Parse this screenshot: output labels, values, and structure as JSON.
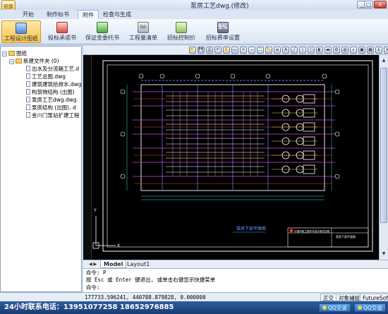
{
  "window": {
    "title": "泵房工艺dwg.(修改)",
    "logo_text": "预算",
    "minimize": "_",
    "maximize": "□",
    "close": "×"
  },
  "tabs": [
    "开始",
    "制作标书",
    "附件",
    "检查与生成"
  ],
  "ribbon": {
    "buttons": [
      {
        "label": "工程设计图纸",
        "icon": "drawing-icon"
      },
      {
        "label": "投标承诺书",
        "icon": "document-icon"
      },
      {
        "label": "保证金委托书",
        "icon": "stamp-icon"
      },
      {
        "label": "工程量清单",
        "icon": "list-icon"
      },
      {
        "label": "招标控制价",
        "icon": "money-icon"
      },
      {
        "label": "招标费率设置",
        "icon": "percent-icon"
      }
    ],
    "list_icon_text": "list",
    "percent_icon_text": "5%"
  },
  "tree": {
    "root": "图纸",
    "folder": "新建文件夹 (0)",
    "files": [
      "出水及分流箱工艺.d",
      "工艺总图.dwg",
      "建筑建筑给排水.dwg",
      "构筑物结构 (出图)",
      "泵房工艺dwg.dwg",
      "泵房结构 (出图). d",
      "金川门泵站扩建工程"
    ]
  },
  "cad": {
    "toolbar_icons": [
      "open-icon",
      "save-icon",
      "print-icon",
      "undo-icon",
      "pan-icon",
      "zoom-window-icon",
      "zoom-in-icon",
      "zoom-out-icon",
      "zoom-extents-icon",
      "measure-icon",
      "layer-icon",
      "text-icon",
      "line-icon",
      "polyline-icon",
      "circle-icon",
      "color-icon",
      "lineweight-icon",
      "settings-icon",
      "globe-icon",
      "search-icon",
      "pdf-icon",
      "picture-icon",
      "info-icon",
      "clear-icon"
    ],
    "ucs_label_y": "Y",
    "ucs_label_x": "X",
    "drawing_title": "泵房下部平面图",
    "company": "中国市政工程华东设计研究总院",
    "sheet_title": "泵房下部平面图"
  },
  "layout_tabs": [
    "Model",
    "Layout1"
  ],
  "command": {
    "line1": "命令: P",
    "line2": "按 Esc 或 Enter 键退出, 或单击右键显示快捷菜单",
    "line3": "命令:"
  },
  "status": {
    "coords": "177733.596241, 440788.879828, 0.000000",
    "buttons": [
      "正交",
      "对象捕捉",
      "FutureSoft"
    ]
  },
  "footer": {
    "phone": "24小时联系电话：13951077258 18652976885",
    "qq1": "QQ交谈",
    "qq2": "QQ交谈"
  }
}
